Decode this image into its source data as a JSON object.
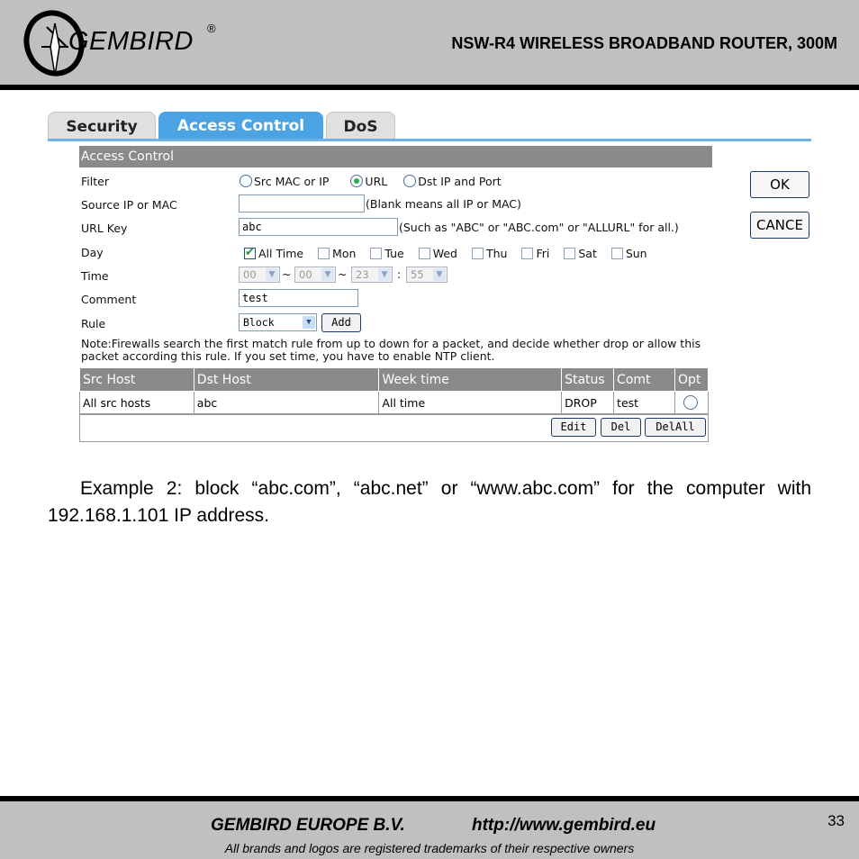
{
  "header": {
    "logo_text": "GEMBIRD",
    "logo_reg": "®",
    "title": "NSW-R4 WIRELESS BROADBAND ROUTER, 300M"
  },
  "tabs": [
    {
      "label": "Security",
      "active": false
    },
    {
      "label": "Access Control",
      "active": true
    },
    {
      "label": "DoS",
      "active": false
    }
  ],
  "panel": {
    "title": "Access Control",
    "filter": {
      "label": "Filter",
      "options": [
        "Src MAC or IP",
        "URL",
        "Dst IP and Port"
      ],
      "selected": "URL"
    },
    "source": {
      "label": "Source IP or MAC",
      "value": "",
      "hint": "(Blank means all IP or MAC)"
    },
    "urlkey": {
      "label": "URL Key",
      "value": "abc",
      "hint": "(Such as \"ABC\" or \"ABC.com\" or \"ALLURL\" for all.)"
    },
    "day": {
      "label": "Day",
      "options": [
        {
          "label": "All Time",
          "checked": true
        },
        {
          "label": "Mon",
          "checked": false
        },
        {
          "label": "Tue",
          "checked": false
        },
        {
          "label": "Wed",
          "checked": false
        },
        {
          "label": "Thu",
          "checked": false
        },
        {
          "label": "Fri",
          "checked": false
        },
        {
          "label": "Sat",
          "checked": false
        },
        {
          "label": "Sun",
          "checked": false
        }
      ]
    },
    "time": {
      "label": "Time",
      "start_hour": "00",
      "start_min": "00",
      "end_hour": "23",
      "end_min": "55",
      "sep_tilde": "~",
      "sep_colon": ":"
    },
    "comment": {
      "label": "Comment",
      "value": "test"
    },
    "rule": {
      "label": "Rule",
      "value": "Block",
      "add_label": "Add"
    },
    "note": "Note:Firewalls search the first match rule from up to down for a packet, and decide whether drop or allow this packet according this rule. If you set time, you have to enable NTP client.",
    "table": {
      "headers": [
        "Src Host",
        "Dst Host",
        "Week time",
        "Status",
        "Comt",
        "Opt"
      ],
      "rows": [
        [
          "All src hosts",
          "abc",
          "All time",
          "DROP",
          "test"
        ]
      ]
    },
    "buttons": {
      "edit": "Edit",
      "del": "Del",
      "delall": "DelAll"
    }
  },
  "side_buttons": {
    "ok": "OK",
    "cancel": "CANCE"
  },
  "paragraph": "Example 2: block “abc.com”, “abc.net” or “www.abc.com” for the computer with 192.168.1.101 IP address.",
  "footer": {
    "company": "GEMBIRD EUROPE B.V.",
    "url": "http://www.gembird.eu",
    "note": "All brands and logos are registered trademarks of their respective owners",
    "page": "33"
  }
}
